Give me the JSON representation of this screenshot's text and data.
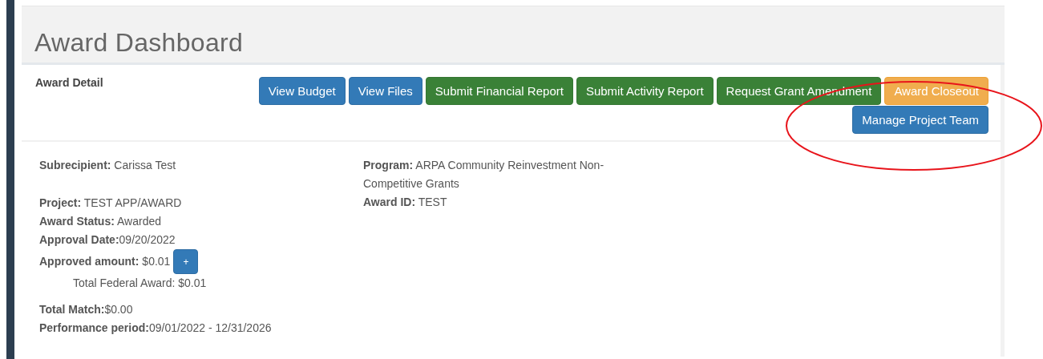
{
  "page_title": "Award Dashboard",
  "section_title": "Award Detail",
  "button_rows": [
    [
      {
        "label": "View Budget",
        "kind": "primary"
      },
      {
        "label": "View Files",
        "kind": "primary"
      },
      {
        "label": "Submit Financial Report",
        "kind": "success"
      },
      {
        "label": "Submit Activity Report",
        "kind": "success"
      },
      {
        "label": "Request Grant Amendment",
        "kind": "success"
      },
      {
        "label": "Award Closeout",
        "kind": "warning"
      }
    ],
    [
      {
        "label": "Manage Project Team",
        "kind": "primary"
      }
    ]
  ],
  "details_left": [
    [
      {
        "text": "**Subrecipient:** Carissa Test",
        "kind": "field"
      }
    ],
    [
      {
        "text": "**Project:** TEST APP/AWARD",
        "kind": "field"
      },
      {
        "text": "**Award Status:** Awarded",
        "kind": "field"
      },
      {
        "text": "**Approval Date:**09/20/2022",
        "kind": "field"
      },
      {
        "text": "**Approved amount:** $0.01",
        "kind": "expandable",
        "button": "+"
      },
      {
        "text": "Total Federal Award: $0.01",
        "kind": "indented"
      }
    ],
    [
      {
        "text": "**Total Match:**$0.00",
        "kind": "field"
      },
      {
        "text": "**Performance period:**09/01/2022 - 12/31/2026",
        "kind": "field"
      }
    ]
  ],
  "details_right": [
    [
      {
        "text": "**Program:** ARPA Community Reinvestment Non-Competitive Grants",
        "kind": "field"
      },
      {
        "text": "**Award ID:** TEST",
        "kind": "field"
      }
    ]
  ],
  "annotations": [
    {
      "kind": "ellipse",
      "color": "#e8141b"
    }
  ]
}
